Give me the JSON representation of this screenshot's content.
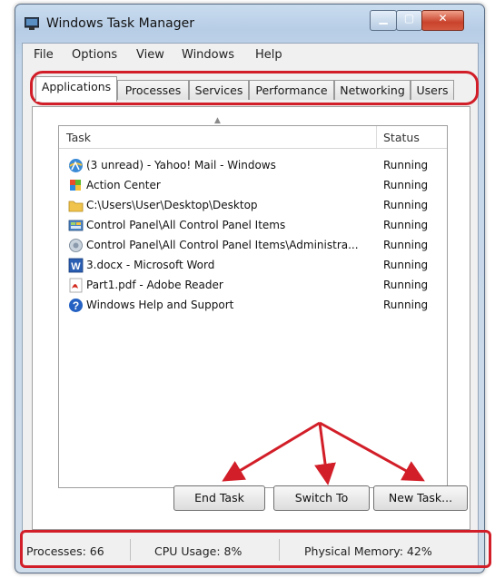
{
  "window": {
    "title": "Windows Task Manager",
    "icon": "task-manager-icon"
  },
  "caption_buttons": {
    "minimize": "minimize-icon",
    "maximize": "maximize-icon",
    "close": "close-icon"
  },
  "menu": [
    "File",
    "Options",
    "View",
    "Windows",
    "Help"
  ],
  "tabs": [
    {
      "label": "Applications",
      "active": true
    },
    {
      "label": "Processes",
      "active": false
    },
    {
      "label": "Services",
      "active": false
    },
    {
      "label": "Performance",
      "active": false
    },
    {
      "label": "Networking",
      "active": false
    },
    {
      "label": "Users",
      "active": false
    }
  ],
  "list": {
    "columns": {
      "task": "Task",
      "status": "Status"
    },
    "rows": [
      {
        "task": "(3 unread) - Yahoo! Mail - Windows",
        "status": "Running",
        "icon": "browser-icon"
      },
      {
        "task": "Action Center",
        "status": "Running",
        "icon": "action-center-flag-icon"
      },
      {
        "task": "C:\\Users\\User\\Desktop\\Desktop",
        "status": "Running",
        "icon": "folder-icon"
      },
      {
        "task": "Control Panel\\All Control Panel Items",
        "status": "Running",
        "icon": "control-panel-icon"
      },
      {
        "task": "Control Panel\\All Control Panel Items\\Administra...",
        "status": "Running",
        "icon": "administrative-tools-icon"
      },
      {
        "task": "3.docx - Microsoft Word",
        "status": "Running",
        "icon": "word-icon"
      },
      {
        "task": "Part1.pdf - Adobe Reader",
        "status": "Running",
        "icon": "pdf-icon"
      },
      {
        "task": "Windows Help and Support",
        "status": "Running",
        "icon": "help-icon"
      }
    ]
  },
  "buttons": {
    "end_task": "End Task",
    "switch_to": "Switch To",
    "new_task": "New Task..."
  },
  "statusbar": {
    "processes": "Processes: 66",
    "cpu": "CPU Usage: 8%",
    "memory": "Physical Memory: 42%"
  },
  "colors": {
    "highlight": "#d21e28",
    "arrow": "#d21e28"
  }
}
